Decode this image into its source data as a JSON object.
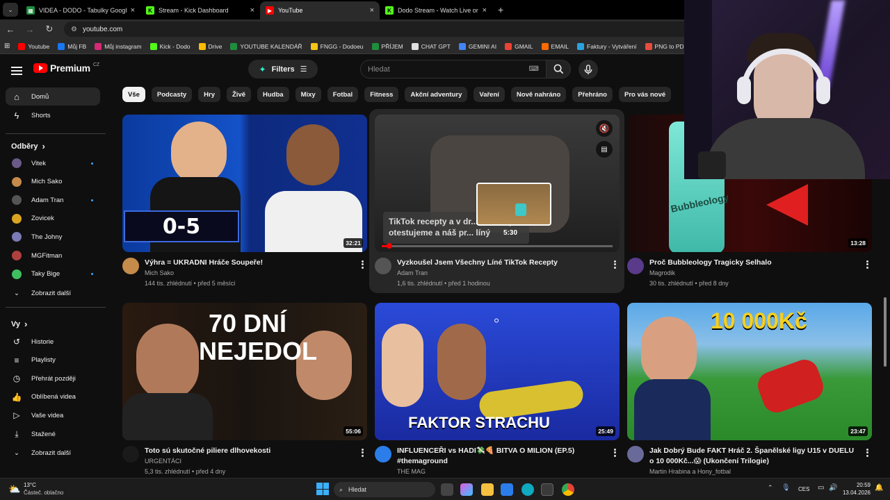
{
  "browser": {
    "tabs": [
      {
        "title": "VIDEA - DODO - Tabulky Googl",
        "color": "#1e8e3e",
        "active": false
      },
      {
        "title": "Stream - Kick Dashboard",
        "color": "#53fc18",
        "active": false
      },
      {
        "title": "YouTube",
        "color": "#ff0000",
        "active": true
      },
      {
        "title": "Dodo Stream - Watch Live on K",
        "color": "#53fc18",
        "active": false
      }
    ],
    "url": "youtube.com",
    "bookmarks": [
      {
        "label": "Youtube",
        "color": "#ff0000"
      },
      {
        "label": "Můj FB",
        "color": "#1877f2"
      },
      {
        "label": "Můj instagram",
        "color": "#d62976"
      },
      {
        "label": "Kick - Dodo",
        "color": "#53fc18"
      },
      {
        "label": "Drive",
        "color": "#fbbc04"
      },
      {
        "label": "YOUTUBE KALENDÁŘ",
        "color": "#1e8e3e"
      },
      {
        "label": "FNGG - Dodoeu",
        "color": "#f5c518"
      },
      {
        "label": "PŘÍJEM",
        "color": "#1e8e3e"
      },
      {
        "label": "CHAT GPT",
        "color": "#e0e0e0"
      },
      {
        "label": "GEMINI AI",
        "color": "#4285f4"
      },
      {
        "label": "GMAIL",
        "color": "#ea4335"
      },
      {
        "label": "EMAIL",
        "color": "#ff6a00"
      },
      {
        "label": "Faktury - Vytváření",
        "color": "#29a3e0"
      },
      {
        "label": "PNG to PDF",
        "color": "#e74c3c"
      }
    ]
  },
  "youtube": {
    "logo_text": "Premium",
    "logo_region": "CZ",
    "filters_label": "Filters",
    "search_placeholder": "Hledat",
    "sidebar": {
      "main": [
        {
          "label": "Domů",
          "active": true
        },
        {
          "label": "Shorts",
          "active": false
        }
      ],
      "subs_heading": "Odběry",
      "subs": [
        {
          "label": "Vitek",
          "color": "#6a5a8a",
          "live_dot": true
        },
        {
          "label": "Mich Sako",
          "color": "#c48b4a",
          "live_dot": false
        },
        {
          "label": "Adam Tran",
          "color": "#555555",
          "live_dot": true
        },
        {
          "label": "Zovicek",
          "color": "#d9a520",
          "live_dot": false
        },
        {
          "label": "The Johny",
          "color": "#7a7ab5",
          "live_dot": false
        },
        {
          "label": "MGFitman",
          "color": "#b04040",
          "live_dot": false
        },
        {
          "label": "Taky Bige",
          "color": "#3fbf5f",
          "live_dot": true
        }
      ],
      "subs_more": "Zobrazit další",
      "you_heading": "Vy",
      "you": [
        {
          "label": "Historie",
          "icon": "history-icon"
        },
        {
          "label": "Playlisty",
          "icon": "playlist-icon"
        },
        {
          "label": "Přehrát později",
          "icon": "clock-icon"
        },
        {
          "label": "Oblíbená videa",
          "icon": "thumb-up-icon"
        },
        {
          "label": "Vaše videa",
          "icon": "video-icon"
        },
        {
          "label": "Stažené",
          "icon": "download-icon"
        }
      ],
      "you_more": "Zobrazit další"
    },
    "chips": [
      "Vše",
      "Podcasty",
      "Hry",
      "Živě",
      "Hudba",
      "Mixy",
      "Fotbal",
      "Fitness",
      "Akční adventury",
      "Vaření",
      "Nově nahráno",
      "Přehráno",
      "Pro vás nové"
    ],
    "videos": [
      {
        "title": "Výhra = UKRADNI Hráče Soupeře!",
        "channel": "Mich Sako",
        "stats": "144 tis. zhlédnutí • před 5 měsíci",
        "duration": "32:21",
        "thumb_text": "0-5",
        "avatar": "#c48b4a"
      },
      {
        "title": "Vyzkoušel Jsem Všechny Líné TikTok Recepty",
        "channel": "Adam Tran",
        "stats": "1,6 tis. zhlédnutí • před 1 hodinou",
        "duration": "",
        "thumb_text": "TikTok recepty a v dr... všechny otestujeme a náš pr... líný",
        "scrub_time": "5:30",
        "avatar": "#555555"
      },
      {
        "title": "Proč Bubbleology Tragicky Selhalo",
        "channel": "Magrodik",
        "stats": "30 tis. zhlédnutí • před 8 dny",
        "duration": "13:28",
        "thumb_text": "Bubbleology",
        "avatar": "#5a3a8a"
      },
      {
        "title": "Toto sú skutočné piliere dlhovekosti",
        "channel": "URGENTÁCI",
        "stats": "5,3 tis. zhlédnutí • před 4 dny",
        "duration": "55:06",
        "thumb_text": "70 DNÍ NEJEDOL",
        "avatar": "#1a1a1a"
      },
      {
        "title": "INFLUENCEŘI vs HADI💸🍕 BITVA O MILION (EP.5) #themaground",
        "channel": "THE MAG",
        "stats": "",
        "duration": "25:49",
        "thumb_text": "FAKTOR STRACHU",
        "avatar": "#2b7de9"
      },
      {
        "title": "Jak Dobrý Bude FAKT Hráč 2. Španělské ligy U15 v DUELU o 10 000Kč...😱 (Ukončení Trilogie)",
        "channel": "Martin Hrabina a Hony_fotbal",
        "stats": "",
        "duration": "23:47",
        "thumb_text": "10 000Kč",
        "avatar": "#6a6a9a"
      }
    ]
  },
  "taskbar": {
    "weather_temp": "13°C",
    "weather_desc": "Částeč. oblačno",
    "search_label": "Hledat",
    "lang": "CES",
    "time": "20:59",
    "date": "13.04.2026"
  }
}
